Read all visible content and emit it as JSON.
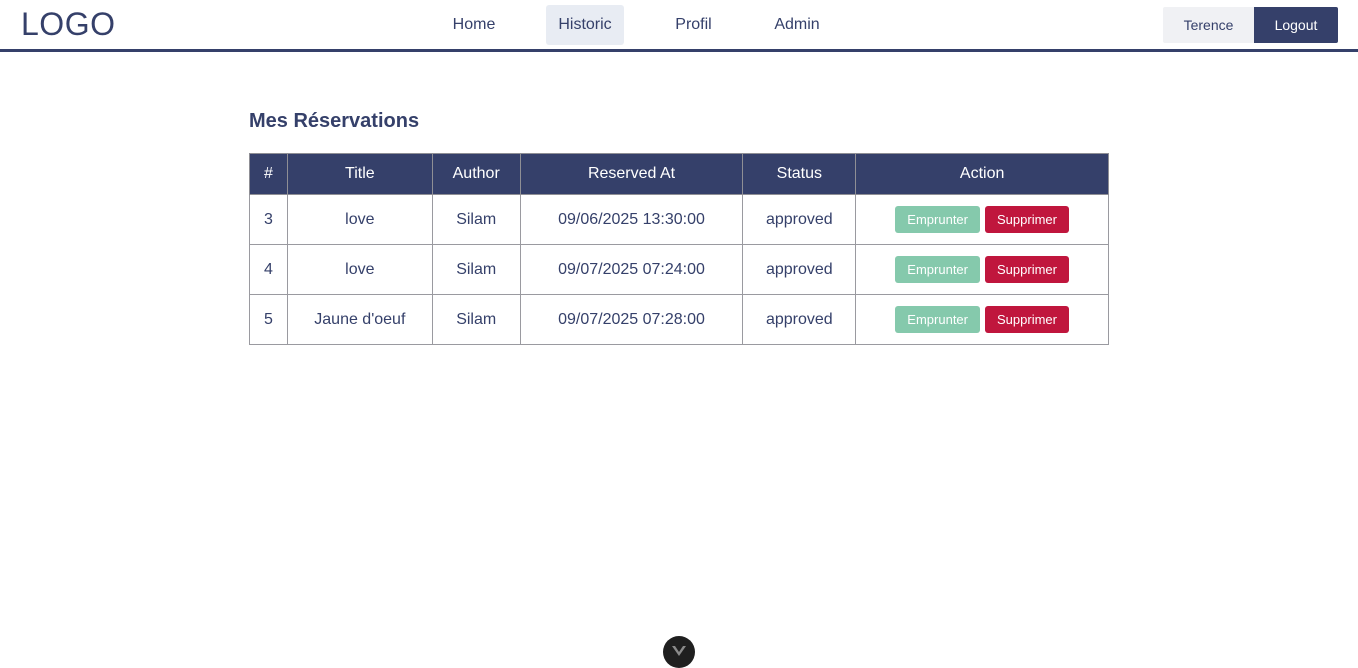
{
  "app": {
    "logo": "LOGO"
  },
  "nav": {
    "links": [
      {
        "label": "Home",
        "active": false
      },
      {
        "label": "Historic",
        "active": true
      },
      {
        "label": "Profil",
        "active": false
      },
      {
        "label": "Admin",
        "active": false
      }
    ],
    "user_label": "Terence",
    "logout_label": "Logout"
  },
  "main": {
    "title": "Mes Réservations",
    "table": {
      "headers": [
        "#",
        "Title",
        "Author",
        "Reserved At",
        "Status",
        "Action"
      ],
      "rows": [
        {
          "id": "3",
          "title": "love",
          "author": "Silam",
          "reserved_at": "09/06/2025 13:30:00",
          "status": "approved"
        },
        {
          "id": "4",
          "title": "love",
          "author": "Silam",
          "reserved_at": "09/07/2025 07:24:00",
          "status": "approved"
        },
        {
          "id": "5",
          "title": "Jaune d'oeuf",
          "author": "Silam",
          "reserved_at": "09/07/2025 07:28:00",
          "status": "approved"
        }
      ],
      "action_labels": {
        "borrow": "Emprunter",
        "delete": "Supprimer"
      }
    }
  },
  "colors": {
    "primary": "#35406a",
    "borrow": "#85c9ac",
    "delete": "#c0163d",
    "active_nav_bg": "#e8ecf3"
  },
  "icons": {
    "scroll_indicator": "chevron-down-icon"
  }
}
